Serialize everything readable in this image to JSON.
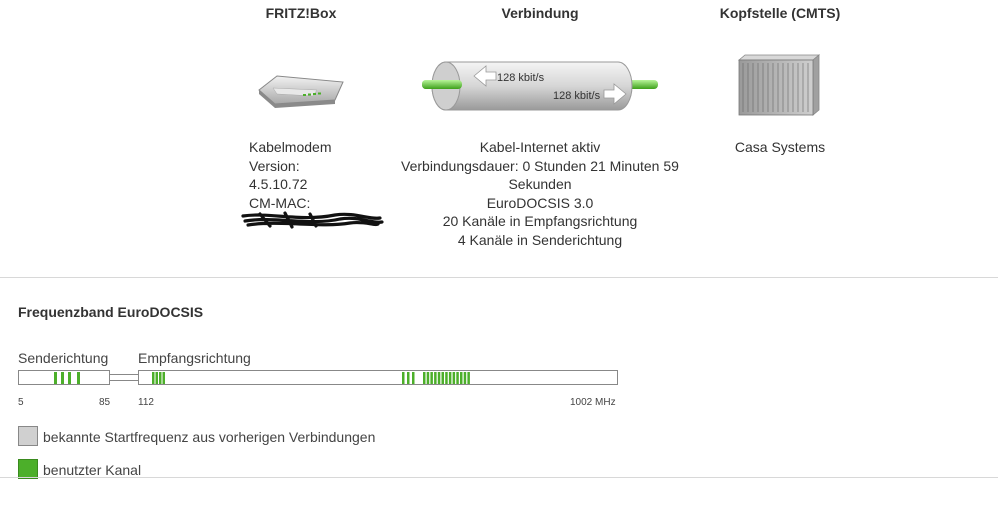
{
  "header": {
    "fritzbox": "FRITZ!Box",
    "connection": "Verbindung",
    "cmts": "Kopfstelle (CMTS)"
  },
  "modem": {
    "type": "Kabelmodem",
    "version_label": "Version:",
    "version": "4.5.10.72",
    "cm_mac_label": "CM-MAC:",
    "icon": "router-icon"
  },
  "connection": {
    "upstream_rate": "128 kbit/s",
    "downstream_rate": "128 kbit/s",
    "status": "Kabel-Internet aktiv",
    "duration_line1": "Verbindungsdauer: 0 Stunden 21 Minuten 59",
    "duration_line2": "Sekunden",
    "standard": "EuroDOCSIS 3.0",
    "downstream_channels": "20 Kanäle in Empfangsrichtung",
    "upstream_channels": "4 Kanäle in Senderichtung"
  },
  "cmts": {
    "vendor": "Casa Systems",
    "icon": "server-rack-icon"
  },
  "band": {
    "title": "Frequenzband EuroDOCSIS",
    "up_label": "Senderichtung",
    "down_label": "Empfangsrichtung",
    "freq_5": "5",
    "freq_85": "85",
    "freq_112": "112",
    "freq_1002": "1002 MHz",
    "up_channels": 4,
    "down_channels": 20
  },
  "legend": {
    "known": "bekannte Startfrequenz aus vorherigen Verbindungen",
    "used": "benutzter Kanal"
  },
  "colors": {
    "used": "#4caf2a",
    "known": "#d0d0d0",
    "border": "#888888"
  }
}
